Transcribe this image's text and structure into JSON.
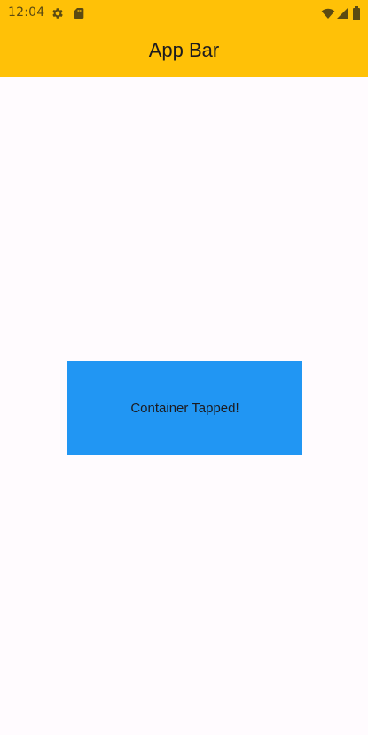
{
  "status_bar": {
    "time": "12:04",
    "left_icons": [
      "settings-icon",
      "sd-card-icon"
    ],
    "right_icons": [
      "wifi-icon",
      "cellular-signal-icon",
      "battery-icon"
    ]
  },
  "app_bar": {
    "title": "App Bar",
    "background": "#ffc107"
  },
  "container": {
    "label": "Container Tapped!",
    "background": "#2196f3"
  },
  "page": {
    "background": "#fffbfe"
  }
}
